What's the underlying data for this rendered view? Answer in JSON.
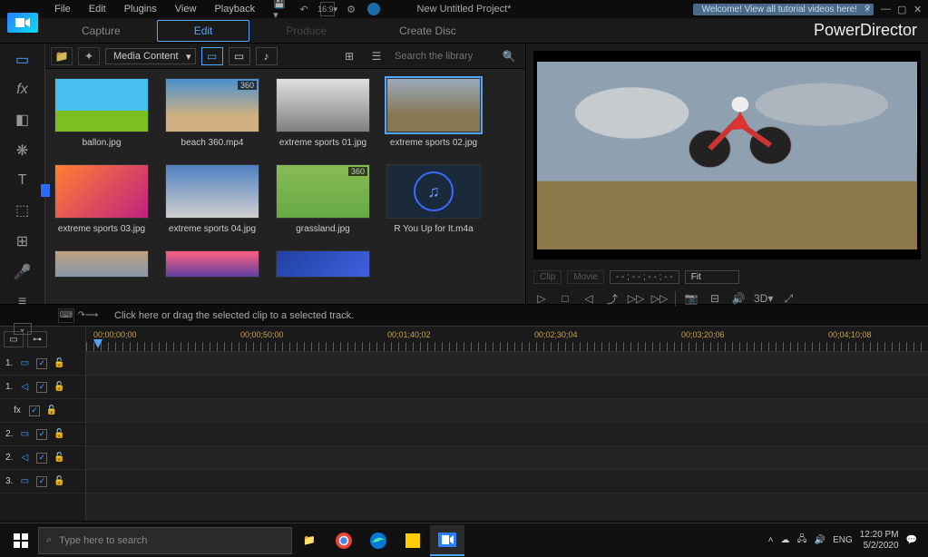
{
  "menubar": {
    "items": [
      "File",
      "Edit",
      "Plugins",
      "View",
      "Playback"
    ],
    "project_title": "New Untitled Project*",
    "welcome_text": "Welcome! View all tutorial videos here!"
  },
  "modebar": {
    "tabs": [
      "Capture",
      "Edit",
      "Produce",
      "Create Disc"
    ],
    "brand": "PowerDirector"
  },
  "media_toolbar": {
    "select_label": "Media Content",
    "search_placeholder": "Search the library"
  },
  "media_items": [
    {
      "label": "ballon.jpg",
      "type": "image"
    },
    {
      "label": "beach 360.mp4",
      "type": "video",
      "badge": "360"
    },
    {
      "label": "extreme sports 01.jpg",
      "type": "image"
    },
    {
      "label": "extreme sports 02.jpg",
      "type": "image",
      "selected": true
    },
    {
      "label": "extreme sports 03.jpg",
      "type": "image"
    },
    {
      "label": "extreme sports 04.jpg",
      "type": "image"
    },
    {
      "label": "grassland.jpg",
      "type": "image",
      "badge": "360"
    },
    {
      "label": "R You Up for It.m4a",
      "type": "audio"
    }
  ],
  "preview": {
    "clip_label": "Clip",
    "movie_label": "Movie",
    "timecode": "- - ; - - ; - - ; - -",
    "fit_label": "Fit",
    "td_label": "3D"
  },
  "timeline_toolbar": {
    "hint": "Click here or drag the selected clip to a selected track."
  },
  "ruler": {
    "marks": [
      "00;00;00;00",
      "00;00;50;00",
      "00;01;40;02",
      "00;02;30;04",
      "00;03;20;06",
      "00;04;10;08"
    ]
  },
  "tracks": [
    {
      "num": "1.",
      "kind": "video"
    },
    {
      "num": "1.",
      "kind": "audio"
    },
    {
      "num": "",
      "kind": "fx"
    },
    {
      "num": "2.",
      "kind": "video"
    },
    {
      "num": "2.",
      "kind": "audio"
    },
    {
      "num": "3.",
      "kind": "video"
    }
  ],
  "taskbar": {
    "search_placeholder": "Type here to search",
    "lang": "ENG",
    "time": "12:20 PM",
    "date": "5/2/2020"
  }
}
